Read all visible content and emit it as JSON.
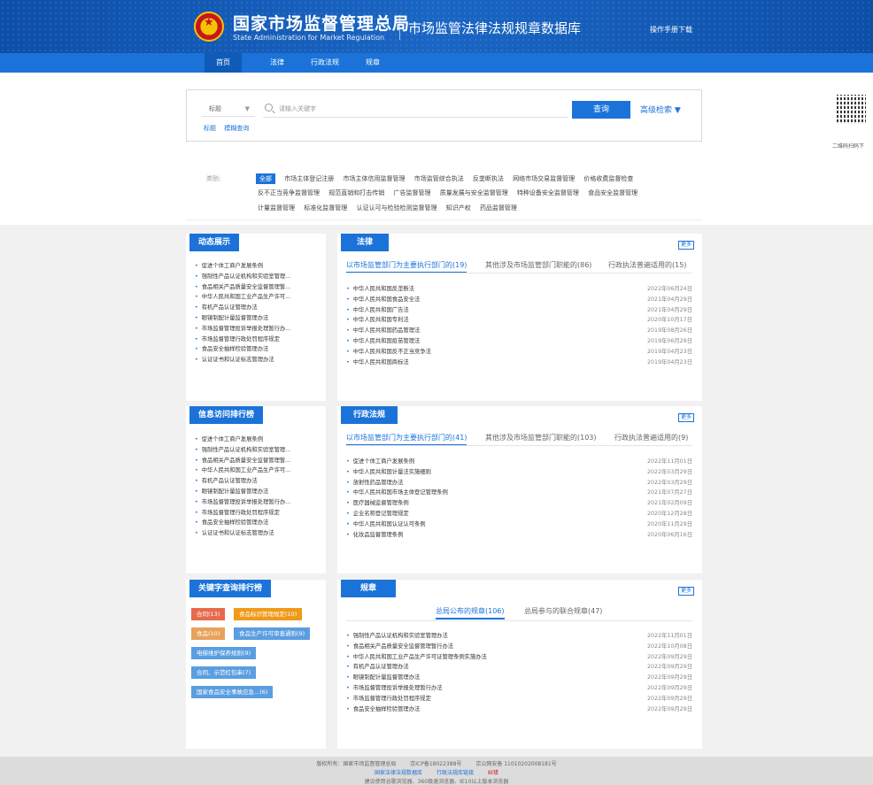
{
  "header": {
    "title_cn": "国家市场监督管理总局",
    "title_en": "State Administration for Market Regulation",
    "db_title": "市场监管法律法规规章数据库",
    "manual_link": "操作手册下载"
  },
  "nav": {
    "items": [
      {
        "label": "首页"
      },
      {
        "label": "法律"
      },
      {
        "label": "行政法规"
      },
      {
        "label": "规章"
      }
    ]
  },
  "search": {
    "field_value": "标题",
    "placeholder": "请输入关键字",
    "button": "查询",
    "advanced": "高级检索 ▼",
    "modes": [
      "标题",
      "模糊查询"
    ]
  },
  "qr_label": "二维码扫码下",
  "categories": {
    "label": "类别:",
    "rows": [
      [
        "全部",
        "市场主体登记注册",
        "市场主体信用监督管理",
        "市场监管综合执法",
        "反垄断执法",
        "网络市场交易监督管理",
        "价格收费监督检查"
      ],
      [
        "反不正当竞争监督管理",
        "规范直销和打击传销",
        "广告监督管理",
        "质量发展与安全监督管理",
        "特种设备安全监督管理",
        "食品安全监督管理"
      ],
      [
        "计量监督管理",
        "标准化监督管理",
        "认证认可与检验检测监督管理",
        "知识产权",
        "药品监督管理"
      ]
    ]
  },
  "side_lists": {
    "dynamic": {
      "title": "动态展示",
      "items": [
        "促进个体工商户发展条例",
        "强制性产品认证机构和实验室管理...",
        "食品相关产品质量安全监督管理暂...",
        "中华人民共和国工业产品生产许可...",
        "有机产品认证管理办法",
        "眼镜制配计量监督管理办法",
        "市场监督管理投诉举报处理暂行办...",
        "市场监督管理行政处罚程序规定",
        "食品安全抽样检验管理办法",
        "认证证书和认证标志管理办法"
      ]
    },
    "ranking": {
      "title": "信息访问排行榜",
      "items": [
        "促进个体工商户发展条例",
        "强制性产品认证机构和实验室管理...",
        "食品相关产品质量安全监督管理暂...",
        "中华人民共和国工业产品生产许可...",
        "有机产品认证管理办法",
        "眼镜制配计量监督管理办法",
        "市场监督管理投诉举报处理暂行办...",
        "市场监督管理行政处罚程序规定",
        "食品安全抽样检验管理办法",
        "认证证书和认证标志管理办法"
      ]
    },
    "keywords": {
      "title": "关键字查询排行榜",
      "tags": [
        {
          "label": "合同(13)",
          "color": "#e86a4d"
        },
        {
          "label": "食品标识管理规定(10)",
          "color": "#f09a1a"
        },
        {
          "label": "食品(10)",
          "color": "#e8a25a"
        },
        {
          "label": "食品生产许可审查通则(9)",
          "color": "#5a9ee0"
        },
        {
          "label": "电梯维护保养规则(9)",
          "color": "#5a9ee0"
        },
        {
          "label": "合同、示范红包串(7)",
          "color": "#5a9ee0"
        },
        {
          "label": "国家食品安全事故应急...(6)",
          "color": "#5a9ee0"
        }
      ]
    }
  },
  "panels": {
    "law": {
      "title": "法律",
      "more": "更多",
      "tabs": [
        "以市场监管部门为主要执行部门的(19)",
        "其他涉及市场监管部门职能的(86)",
        "行政执法普遍适用的(15)"
      ],
      "rows": [
        {
          "name": "中华人民共和国反垄断法",
          "date": "2022年06月24日"
        },
        {
          "name": "中华人民共和国食品安全法",
          "date": "2021年04月29日"
        },
        {
          "name": "中华人民共和国广告法",
          "date": "2021年04月29日"
        },
        {
          "name": "中华人民共和国专利法",
          "date": "2020年10月17日"
        },
        {
          "name": "中华人民共和国药品管理法",
          "date": "2019年08月26日"
        },
        {
          "name": "中华人民共和国疫苗管理法",
          "date": "2019年06月29日"
        },
        {
          "name": "中华人民共和国反不正当竞争法",
          "date": "2019年04月23日"
        },
        {
          "name": "中华人民共和国商标法",
          "date": "2019年04月23日"
        }
      ]
    },
    "regulation": {
      "title": "行政法规",
      "more": "更多",
      "tabs": [
        "以市场监管部门为主要执行部门的(41)",
        "其他涉及市场监管部门职能的(103)",
        "行政执法普遍适用的(9)"
      ],
      "rows": [
        {
          "name": "促进个体工商户发展条例",
          "date": "2022年11月01日"
        },
        {
          "name": "中华人民共和国计量法实施细则",
          "date": "2022年03月29日"
        },
        {
          "name": "放射性药品管理办法",
          "date": "2022年03月29日"
        },
        {
          "name": "中华人民共和国市场主体登记管理条例",
          "date": "2021年07月27日"
        },
        {
          "name": "医疗器械监督管理条例",
          "date": "2021年02月09日"
        },
        {
          "name": "企业名称登记管理规定",
          "date": "2020年12月28日"
        },
        {
          "name": "中华人民共和国认证认可条例",
          "date": "2020年11月29日"
        },
        {
          "name": "化妆品监督管理条例",
          "date": "2020年06月16日"
        }
      ]
    },
    "rules": {
      "title": "规章",
      "more": "更多",
      "tabs": [
        "总局公布的规章(106)",
        "总局参与的联合规章(47)"
      ],
      "rows": [
        {
          "name": "强制性产品认证机构和实验室管理办法",
          "date": "2022年11月01日"
        },
        {
          "name": "食品相关产品质量安全监督管理暂行办法",
          "date": "2022年10月08日"
        },
        {
          "name": "中华人民共和国工业产品生产许可证管理条例实施办法",
          "date": "2022年09月29日"
        },
        {
          "name": "有机产品认证管理办法",
          "date": "2022年09月29日"
        },
        {
          "name": "眼镜制配计量监督管理办法",
          "date": "2022年09月29日"
        },
        {
          "name": "市场监督管理投诉举报处理暂行办法",
          "date": "2022年09月29日"
        },
        {
          "name": "市场监督管理行政处罚程序规定",
          "date": "2022年09月29日"
        },
        {
          "name": "食品安全抽样检验管理办法",
          "date": "2022年09月29日"
        }
      ]
    }
  },
  "footer": {
    "line1": [
      "版权所有：国家市场监督管理总局",
      "京ICP备18022388号",
      "京公网安备 11010202008181号"
    ],
    "line2": [
      "国家法律法规数据库",
      "行政法规库链接",
      "纠错"
    ],
    "line3": "建议使用谷歌浏览器、360极速浏览器、IE10以上版本浏览器"
  }
}
